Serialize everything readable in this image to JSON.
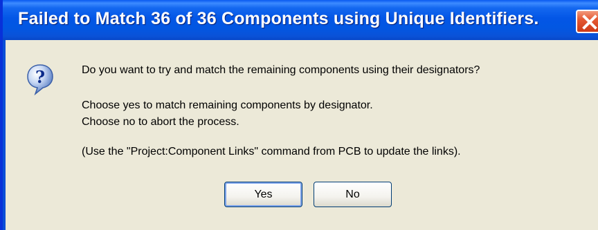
{
  "dialog": {
    "title": "Failed to Match 36 of 36 Components using Unique Identifiers.",
    "icon": "question-icon",
    "message_line1": "Do you want to try and match the remaining components using their designators?",
    "message_line2": "Choose yes to match remaining components by designator.",
    "message_line3": "Choose no to abort the process.",
    "message_line4": "(Use the \"Project:Component Links\" command from PCB to update the links).",
    "buttons": {
      "yes_label": "Yes",
      "no_label": "No"
    }
  },
  "colors": {
    "titlebar": "#0356e6",
    "client_background": "#ece9d8",
    "close_button": "#e45a34",
    "button_border": "#003c74"
  }
}
